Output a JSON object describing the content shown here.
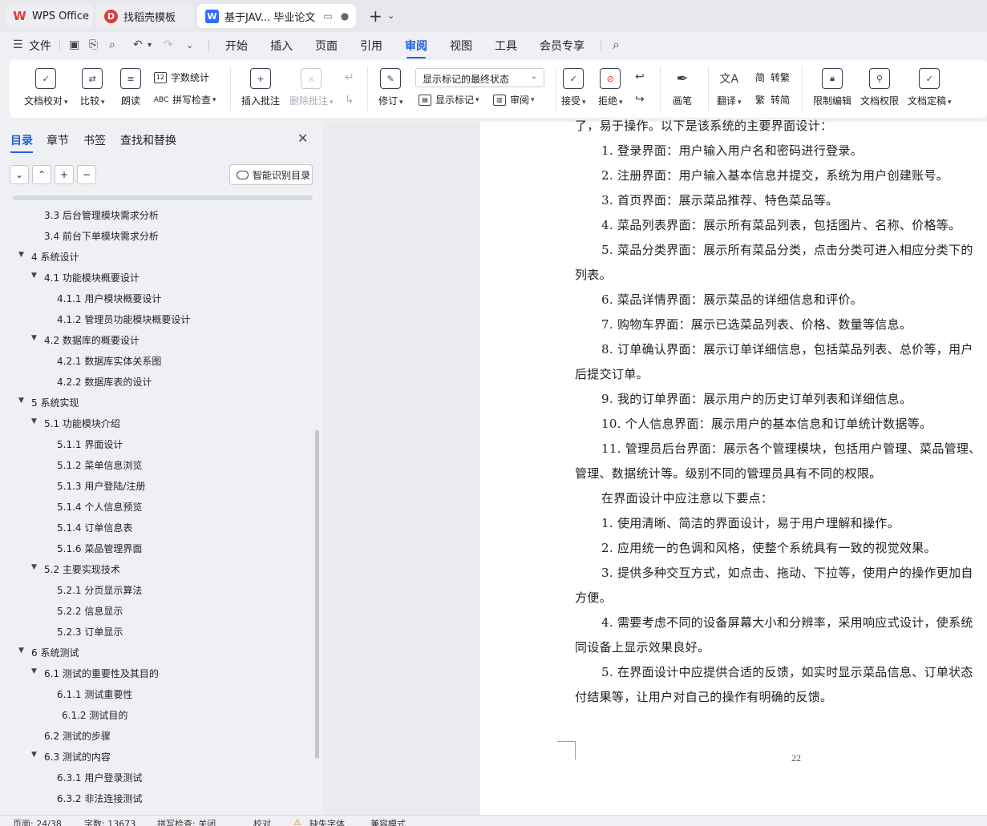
{
  "tabs": {
    "wps": "WPS Office",
    "template": "找稻壳模板",
    "document": "基于JAV... 毕业论文"
  },
  "menu": {
    "file": "文件",
    "items": [
      "开始",
      "插入",
      "页面",
      "引用",
      "审阅",
      "视图",
      "工具",
      "会员专享"
    ],
    "active": "审阅"
  },
  "ribbon": {
    "doc_check": "文档校对",
    "compare": "比较",
    "read_aloud": "朗读",
    "word_count": "字数统计",
    "spell_check": "拼写检查",
    "insert_comment": "插入批注",
    "delete_comment": "删除批注",
    "revise": "修订",
    "markup_state": "显示标记的最终状态",
    "show_markup": "显示标记",
    "review": "审阅",
    "accept": "接受",
    "reject": "拒绝",
    "draw": "画笔",
    "translate": "翻译",
    "to_traditional": "转繁",
    "to_simplified": "转简",
    "restrict_edit": "限制编辑",
    "doc_permission": "文档权限",
    "doc_finalize": "文档定稿"
  },
  "panel": {
    "tabs": [
      "目录",
      "章节",
      "书签",
      "查找和替换"
    ],
    "smart_toc": "智能识别目录",
    "toc": [
      {
        "text": "3.3 后台管理模块需求分析",
        "level": 2,
        "caret": false
      },
      {
        "text": "3.4 前台下单模块需求分析",
        "level": 2,
        "caret": false
      },
      {
        "text": "4  系统设计",
        "level": 1,
        "caret": true
      },
      {
        "text": "4.1 功能模块概要设计",
        "level": 2,
        "caret": true
      },
      {
        "text": "4.1.1 用户模块概要设计",
        "level": 3,
        "caret": false
      },
      {
        "text": "4.1.2 管理员功能模块概要设计",
        "level": 3,
        "caret": false
      },
      {
        "text": "4.2 数据库的概要设计",
        "level": 2,
        "caret": true
      },
      {
        "text": "4.2.1 数据库实体关系图",
        "level": 3,
        "caret": false
      },
      {
        "text": "4.2.2 数据库表的设计",
        "level": 3,
        "caret": false
      },
      {
        "text": "5  系统实现",
        "level": 1,
        "caret": true
      },
      {
        "text": "5.1 功能模块介绍",
        "level": 2,
        "caret": true
      },
      {
        "text": "5.1.1 界面设计",
        "level": 3,
        "caret": false
      },
      {
        "text": "5.1.2  菜单信息浏览",
        "level": 3,
        "caret": false
      },
      {
        "text": "5.1.3  用户登陆/注册",
        "level": 3,
        "caret": false
      },
      {
        "text": "5.1.4  个人信息预览",
        "level": 3,
        "caret": false
      },
      {
        "text": "5.1.4  订单信息表",
        "level": 3,
        "caret": false
      },
      {
        "text": "5.1.6  菜品管理界面",
        "level": 3,
        "caret": false
      },
      {
        "text": "5.2 主要实现技术",
        "level": 2,
        "caret": true
      },
      {
        "text": "5.2.1 分页显示算法",
        "level": 3,
        "caret": false
      },
      {
        "text": "5.2.2  信息显示",
        "level": 3,
        "caret": false
      },
      {
        "text": "5.2.3  订单显示",
        "level": 3,
        "caret": false
      },
      {
        "text": "6  系统测试",
        "level": 1,
        "caret": true
      },
      {
        "text": "6.1 测试的重要性及其目的",
        "level": 2,
        "caret": true
      },
      {
        "text": "6.1.1 测试重要性",
        "level": 3,
        "caret": false
      },
      {
        "text": "6.1.2 测试目的",
        "level": 3,
        "caret": false,
        "extra_indent": true
      },
      {
        "text": "6.2 测试的步骤",
        "level": 2,
        "caret": false
      },
      {
        "text": "6.3 测试的内容",
        "level": 2,
        "caret": true
      },
      {
        "text": "6.3.1 用户登录测试",
        "level": 3,
        "caret": false
      },
      {
        "text": "6.3.2 非法连接测试",
        "level": 3,
        "caret": false
      }
    ]
  },
  "document": {
    "lines": [
      {
        "text": "了，易于操作。以下是该系统的主要界面设计：",
        "indent": 0
      },
      {
        "text": "1.  登录界面：用户输入用户名和密码进行登录。",
        "indent": 1
      },
      {
        "text": "2.  注册界面：用户输入基本信息并提交，系统为用户创建账号。",
        "indent": 1
      },
      {
        "text": "3.  首页界面：展示菜品推荐、特色菜品等。",
        "indent": 1
      },
      {
        "text": "4.  菜品列表界面：展示所有菜品列表，包括图片、名称、价格等。",
        "indent": 1
      },
      {
        "text": "5.  菜品分类界面：展示所有菜品分类，点击分类可进入相应分类下的",
        "indent": 1
      },
      {
        "text": "列表。",
        "indent": 0
      },
      {
        "text": "6.  菜品详情界面：展示菜品的详细信息和评价。",
        "indent": 1
      },
      {
        "text": "7.  购物车界面：展示已选菜品列表、价格、数量等信息。",
        "indent": 1
      },
      {
        "text": "8.  订单确认界面：展示订单详细信息，包括菜品列表、总价等，用户",
        "indent": 1
      },
      {
        "text": "后提交订单。",
        "indent": 0
      },
      {
        "text": "9.  我的订单界面：展示用户的历史订单列表和详细信息。",
        "indent": 1
      },
      {
        "text": "10.  个人信息界面：展示用户的基本信息和订单统计数据等。",
        "indent": 1
      },
      {
        "text": "11.  管理员后台界面：展示各个管理模块，包括用户管理、菜品管理、",
        "indent": 1
      },
      {
        "text": "管理、数据统计等。级别不同的管理员具有不同的权限。",
        "indent": 0
      },
      {
        "text": "在界面设计中应注意以下要点：",
        "indent": 1
      },
      {
        "text": "1.  使用清晰、简洁的界面设计，易于用户理解和操作。",
        "indent": 1
      },
      {
        "text": "2.  应用统一的色调和风格，使整个系统具有一致的视觉效果。",
        "indent": 1
      },
      {
        "text": "3.  提供多种交互方式，如点击、拖动、下拉等，使用户的操作更加自",
        "indent": 1
      },
      {
        "text": "方便。",
        "indent": 0
      },
      {
        "text": "4.  需要考虑不同的设备屏幕大小和分辨率，采用响应式设计，使系统",
        "indent": 1
      },
      {
        "text": "同设备上显示效果良好。",
        "indent": 0
      },
      {
        "text": "5.  在界面设计中应提供合适的反馈，如实时显示菜品信息、订单状态",
        "indent": 1
      },
      {
        "text": "付结果等，让用户对自己的操作有明确的反馈。",
        "indent": 0
      }
    ],
    "page_number": "22"
  },
  "status": {
    "page": "页面: 24/38",
    "words": "字数: 13673",
    "spell": "拼写检查: 关闭",
    "proof": "校对",
    "missing_font": "缺失字体",
    "compat": "兼容模式"
  },
  "colors": {
    "accent": "#1f5ee6",
    "wps_red": "#e53935",
    "doc_blue": "#2f6bff"
  }
}
